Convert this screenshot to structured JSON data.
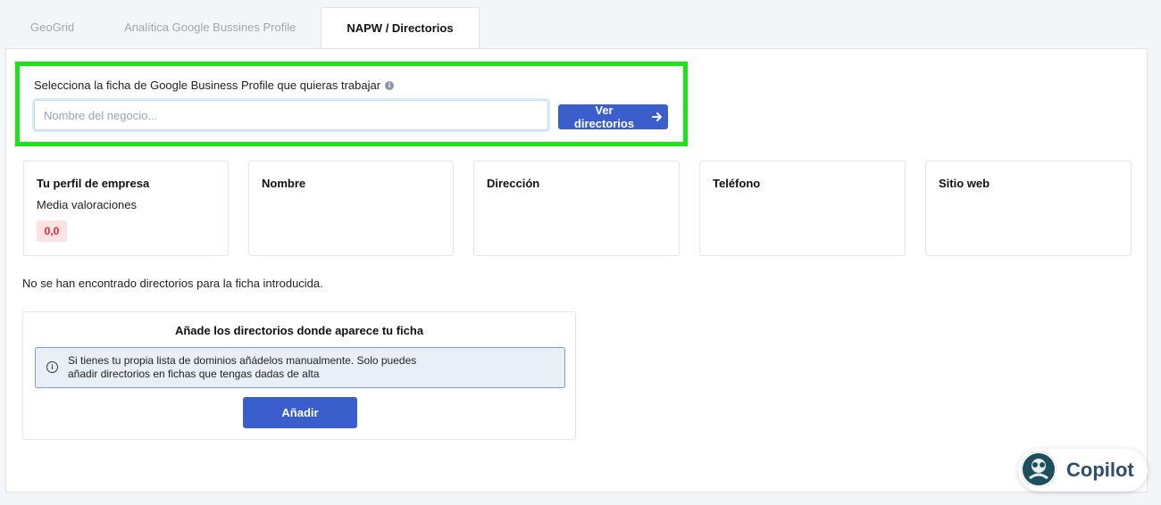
{
  "tabs": [
    {
      "label": "GeoGrid",
      "active": false
    },
    {
      "label": "Analítica Google Bussines Profile",
      "active": false
    },
    {
      "label": "NAPW / Directorios",
      "active": true
    }
  ],
  "selector": {
    "label": "Selecciona la ficha de Google Business Profile que quieras trabajar",
    "info_icon": "info-icon",
    "input_placeholder": "Nombre del negocio...",
    "input_value": "",
    "button_label": "Ver directorios",
    "button_icon": "arrow-right-icon"
  },
  "cards": {
    "profile": {
      "title": "Tu perfil de empresa",
      "subtitle": "Media valoraciones",
      "rating": "0,0"
    },
    "name": {
      "title": "Nombre"
    },
    "address": {
      "title": "Dirección"
    },
    "phone": {
      "title": "Teléfono"
    },
    "website": {
      "title": "Sitio web"
    }
  },
  "status_message": "No se han encontrado directorios para la ficha introducida.",
  "add_section": {
    "title": "Añade los directorios donde aparece tu ficha",
    "alert_text": "Si tienes tu propia lista de dominios añádelos manualmente. Solo puedes añadir directorios en fichas que tengas dadas de alta",
    "button_label": "Añadir"
  },
  "copilot": {
    "label": "Copilot"
  },
  "colors": {
    "accent": "#3a5fcd",
    "highlight": "#1ee31a",
    "rating_badge_bg": "#fde2e4",
    "rating_badge_text": "#d6293e"
  }
}
